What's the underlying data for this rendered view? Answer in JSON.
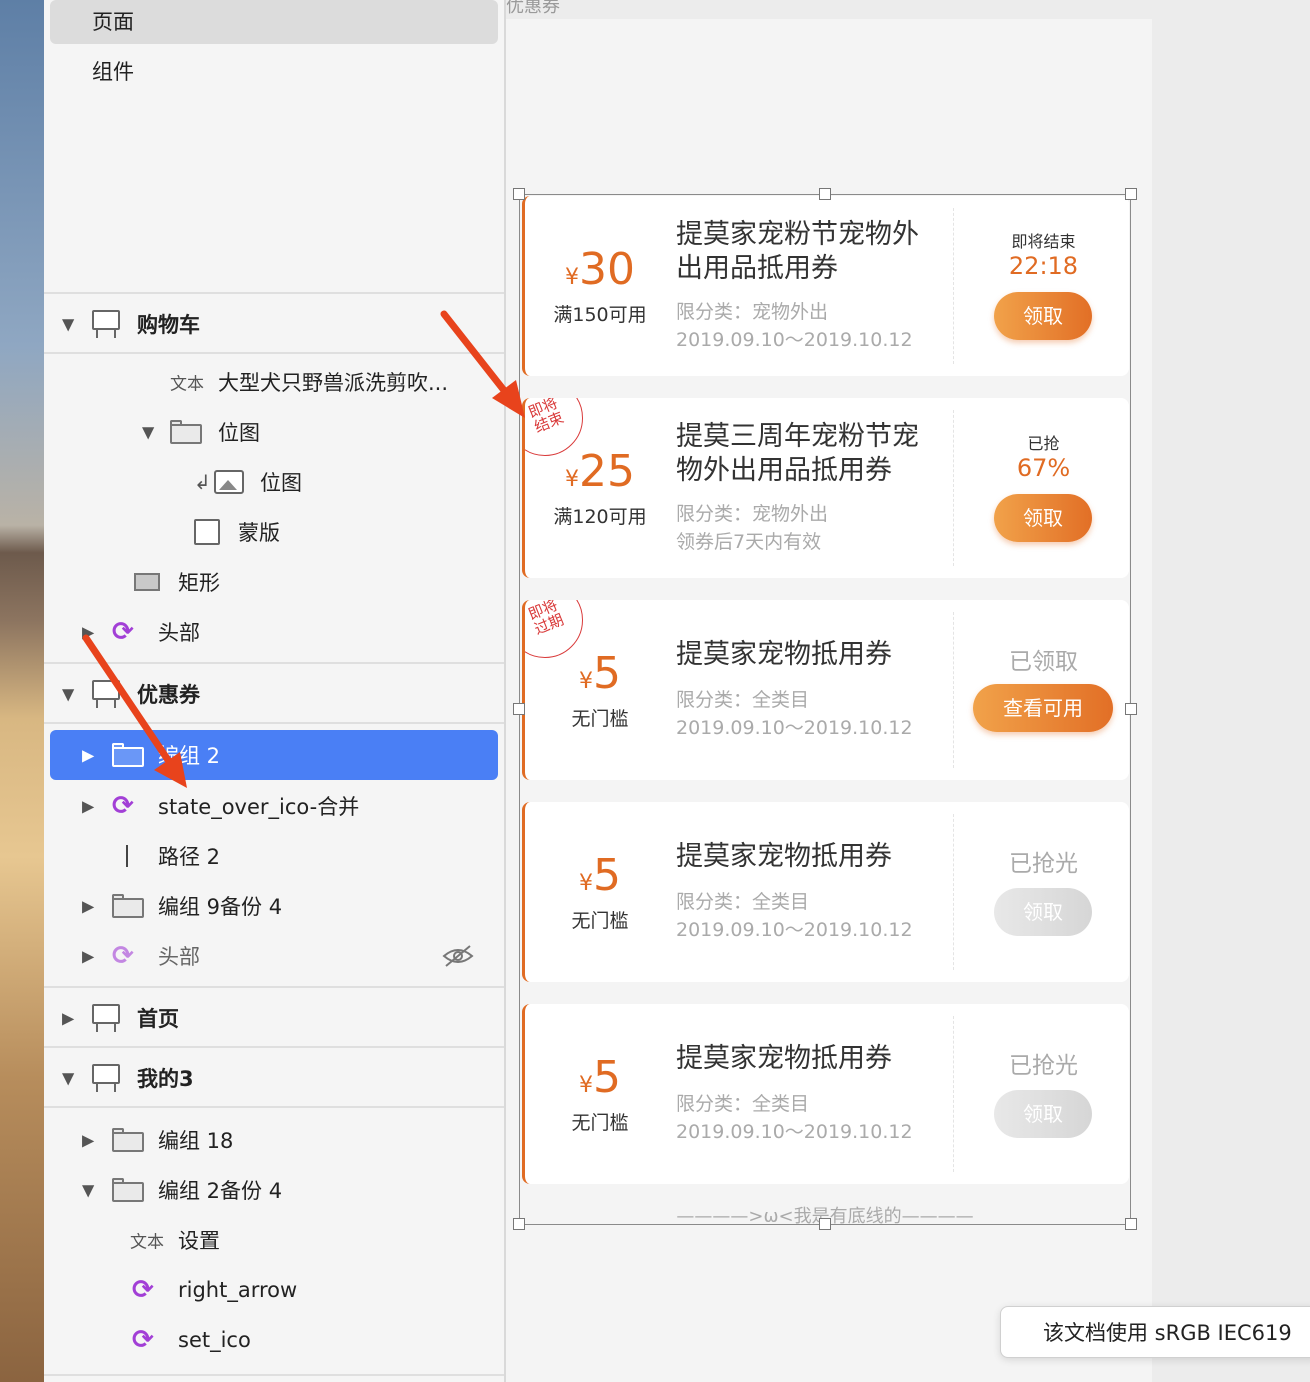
{
  "sidebar": {
    "pages_items": [
      {
        "label": "页面",
        "selected": true
      },
      {
        "label": "组件",
        "selected": false
      }
    ],
    "cart": {
      "label": "购物车",
      "text_kind": "文本",
      "text_value": "大型犬只野兽派洗剪吹...",
      "bitmap_group": "位图",
      "bitmap": "位图",
      "mask": "蒙版",
      "rect": "矩形",
      "header": "头部"
    },
    "coupon": {
      "label": "优惠券",
      "group2": "编组 2",
      "state_over": "state_over_ico-合并",
      "path2": "路径 2",
      "group9": "编组 9备份 4",
      "header": "头部"
    },
    "home": {
      "label": "首页"
    },
    "mine": {
      "label": "我的3",
      "group18": "编组 18",
      "group2copy": "编组 2备份 4",
      "text_kind": "文本",
      "text_value": "设置",
      "right_arrow": "right_arrow",
      "set_ico": "set_ico"
    }
  },
  "canvas": {
    "artboard_title": "优惠券",
    "footer": "————>ω<我是有底线的————",
    "accent_color": "#e06b23",
    "selection_color": "#4a7ff5"
  },
  "coupons": [
    {
      "yen": "¥",
      "amount": "30",
      "condition": "满150可用",
      "title_l1": "提莫家宠粉节宠物外",
      "title_l2": "出用品抵用券",
      "category": "限分类：宠物外出",
      "validity": "2019.09.10～2019.10.12",
      "status_label": "即将结束",
      "status_value": "22:18",
      "button": "领取"
    },
    {
      "yen": "¥",
      "amount": "25",
      "condition": "满120可用",
      "title_l1": "提莫三周年宠粉节宠",
      "title_l2": "物外出用品抵用券",
      "category": "限分类：宠物外出",
      "validity": "领券后7天内有效",
      "stamp_l1": "即将",
      "stamp_l2": "结束",
      "status_label": "已抢",
      "status_value": "67%",
      "button": "领取"
    },
    {
      "yen": "¥",
      "amount": "5",
      "condition": "无门槛",
      "title_l1": "提莫家宠物抵用券",
      "category": "限分类：全类目",
      "validity": "2019.09.10～2019.10.12",
      "stamp_l1": "即将",
      "stamp_l2": "过期",
      "status_grey": "已领取",
      "button": "查看可用"
    },
    {
      "yen": "¥",
      "amount": "5",
      "condition": "无门槛",
      "title_l1": "提莫家宠物抵用券",
      "category": "限分类：全类目",
      "validity": "2019.09.10～2019.10.12",
      "status_grey": "已抢光",
      "button": "领取"
    },
    {
      "yen": "¥",
      "amount": "5",
      "condition": "无门槛",
      "title_l1": "提莫家宠物抵用券",
      "category": "限分类：全类目",
      "validity": "2019.09.10～2019.10.12",
      "status_grey": "已抢光",
      "button": "领取"
    }
  ],
  "toast": {
    "text": "该文档使用 sRGB IEC619"
  }
}
